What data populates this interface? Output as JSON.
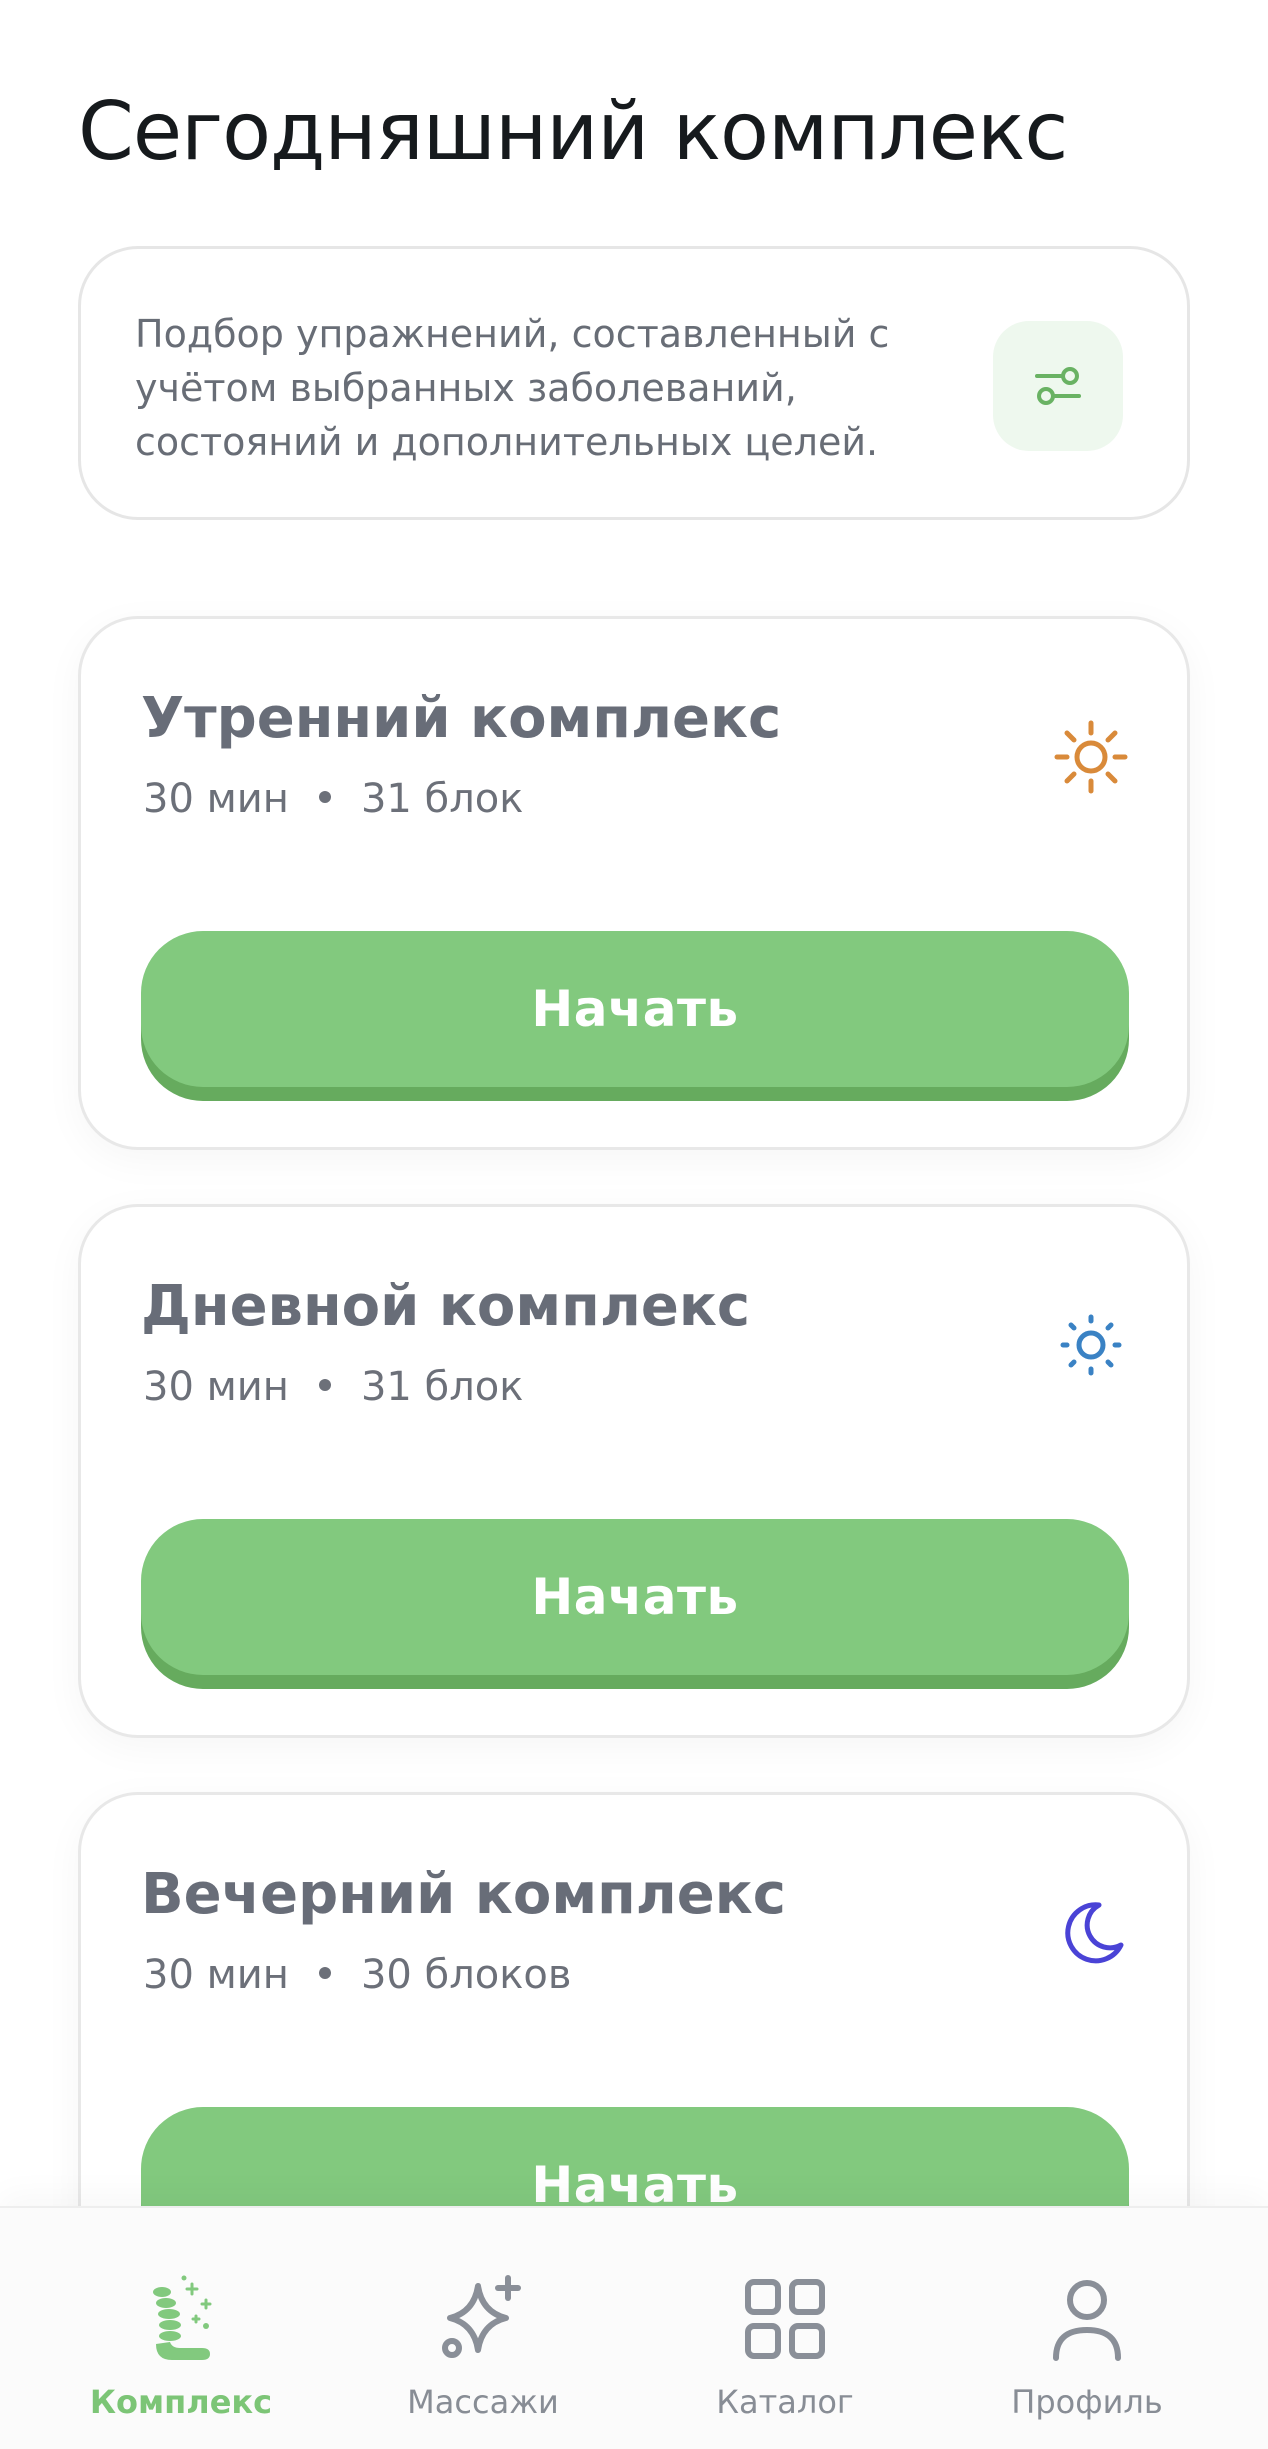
{
  "page": {
    "title": "Сегодняшний комплекс"
  },
  "info_card": {
    "text": "Подбор упражнений, составленный с учётом выбранных заболеваний, состояний и дополнительных целей.",
    "icon": "sliders-icon"
  },
  "routines": [
    {
      "title": "Утренний комплекс",
      "duration": "30 мин",
      "blocks": "31 блок",
      "icon": "sun-icon",
      "icon_color": "#d98a3a",
      "button_label": "Начать"
    },
    {
      "title": "Дневной комплекс",
      "duration": "30 мин",
      "blocks": "31 блок",
      "icon": "sun-small-icon",
      "icon_color": "#3a82c4",
      "button_label": "Начать"
    },
    {
      "title": "Вечерний комплекс",
      "duration": "30 мин",
      "blocks": "30 блоков",
      "icon": "moon-icon",
      "icon_color": "#4a43d6",
      "button_label": "Начать"
    }
  ],
  "nav": {
    "items": [
      {
        "label": "Комплекс",
        "icon": "spine-icon",
        "active": true
      },
      {
        "label": "Массажи",
        "icon": "sparkle-icon",
        "active": false
      },
      {
        "label": "Каталог",
        "icon": "grid-icon",
        "active": false
      },
      {
        "label": "Профиль",
        "icon": "user-icon",
        "active": false
      }
    ]
  },
  "colors": {
    "accent": "#82c97e",
    "accent_dark": "#66ab5e",
    "text_primary": "#161a1d",
    "text_secondary": "#686d78",
    "nav_inactive": "#888d95"
  }
}
